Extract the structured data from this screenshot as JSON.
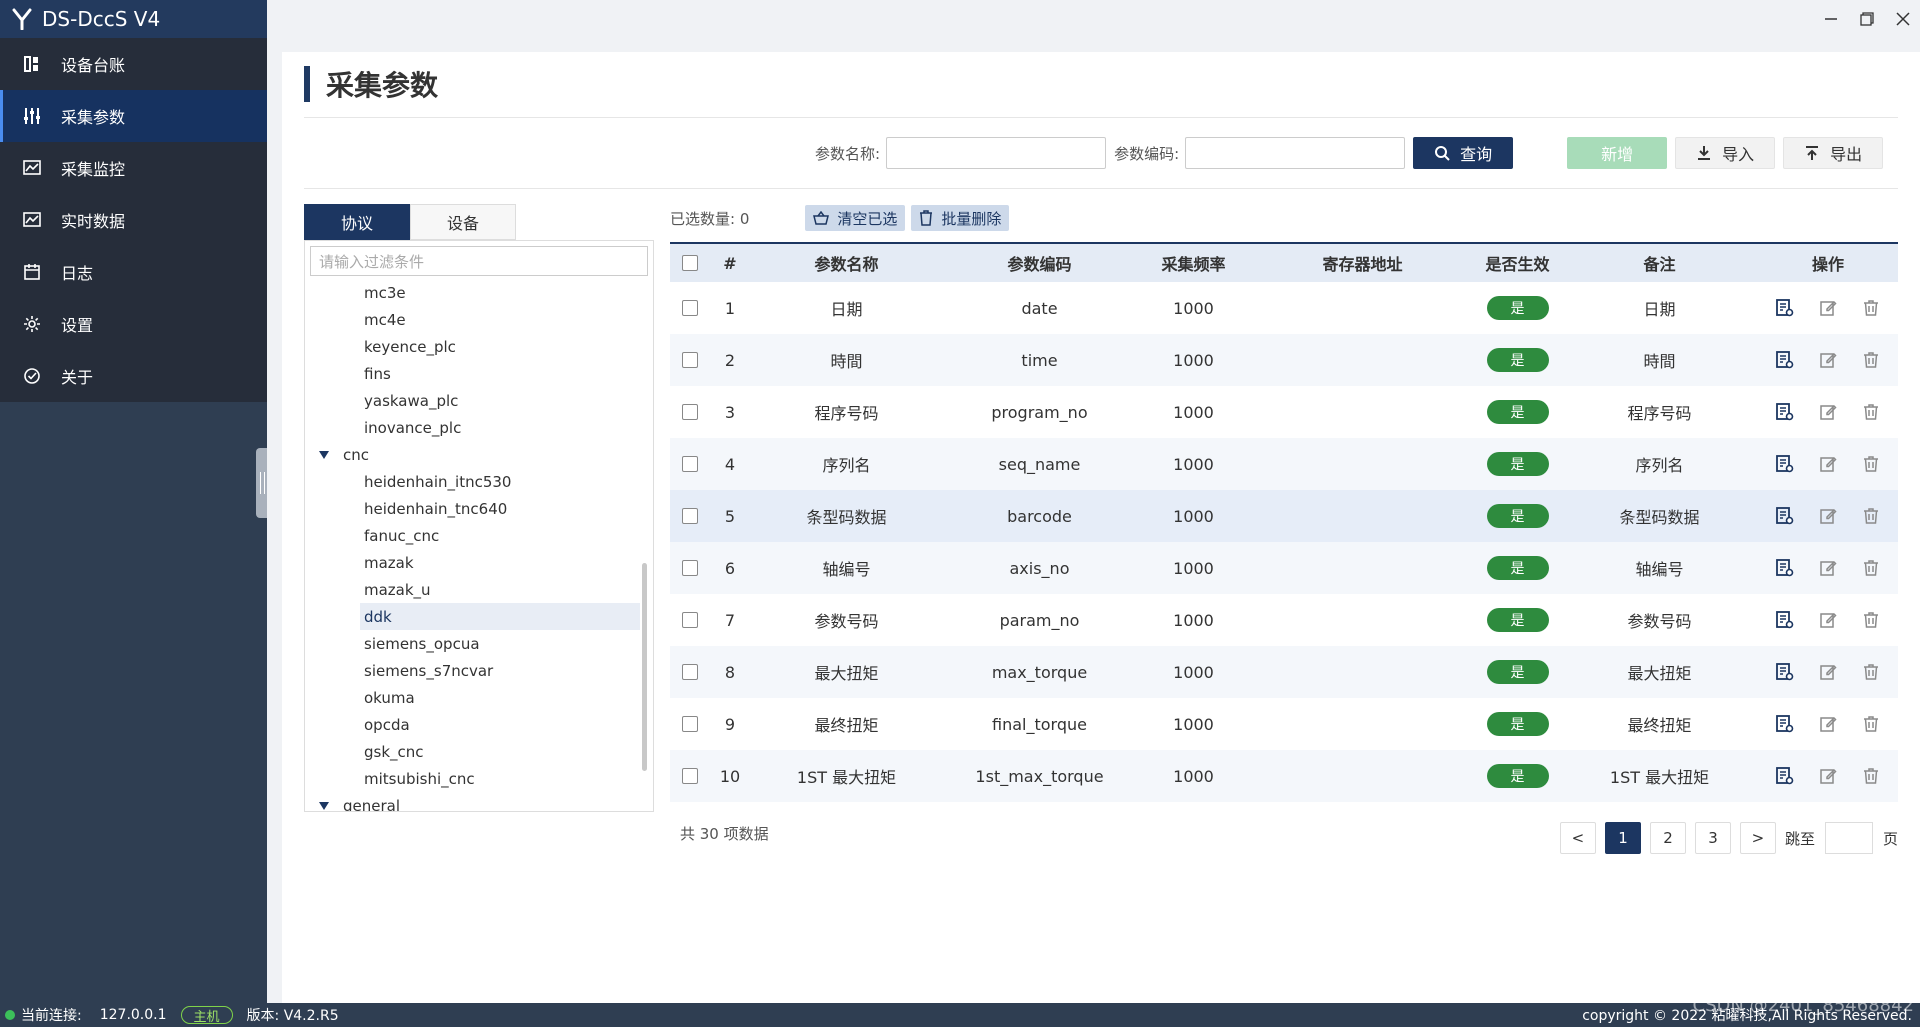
{
  "app": {
    "title": "DS-DccS V4"
  },
  "sidebar": {
    "items": [
      {
        "label": "设备台账",
        "icon": "ledger-icon"
      },
      {
        "label": "采集参数",
        "icon": "sliders-icon",
        "active": true
      },
      {
        "label": "采集监控",
        "icon": "chart-icon"
      },
      {
        "label": "实时数据",
        "icon": "chart-icon"
      },
      {
        "label": "日志",
        "icon": "calendar-icon"
      },
      {
        "label": "设置",
        "icon": "gear-icon"
      },
      {
        "label": "关于",
        "icon": "check-circle-icon"
      }
    ]
  },
  "page": {
    "title": "采集参数"
  },
  "search": {
    "param_name_label": "参数名称:",
    "param_code_label": "参数编码:",
    "query_label": "查询",
    "add_label": "新增",
    "import_label": "导入",
    "export_label": "导出"
  },
  "left_panel": {
    "tabs": [
      "协议",
      "设备"
    ],
    "filter_placeholder": "请输入过滤条件",
    "tree": [
      {
        "label": "mc3e",
        "type": "child"
      },
      {
        "label": "mc4e",
        "type": "child"
      },
      {
        "label": "keyence_plc",
        "type": "child"
      },
      {
        "label": "fins",
        "type": "child"
      },
      {
        "label": "yaskawa_plc",
        "type": "child"
      },
      {
        "label": "inovance_plc",
        "type": "child"
      },
      {
        "label": "cnc",
        "type": "parent"
      },
      {
        "label": "heidenhain_itnc530",
        "type": "child"
      },
      {
        "label": "heidenhain_tnc640",
        "type": "child"
      },
      {
        "label": "fanuc_cnc",
        "type": "child"
      },
      {
        "label": "mazak",
        "type": "child"
      },
      {
        "label": "mazak_u",
        "type": "child"
      },
      {
        "label": "ddk",
        "type": "child",
        "selected": true
      },
      {
        "label": "siemens_opcua",
        "type": "child"
      },
      {
        "label": "siemens_s7ncvar",
        "type": "child"
      },
      {
        "label": "okuma",
        "type": "child"
      },
      {
        "label": "opcda",
        "type": "child"
      },
      {
        "label": "gsk_cnc",
        "type": "child"
      },
      {
        "label": "mitsubishi_cnc",
        "type": "child"
      },
      {
        "label": "general",
        "type": "parent"
      }
    ]
  },
  "table": {
    "selected_label": "已选数量: 0",
    "clear_label": "清空已选",
    "batch_delete_label": "批量删除",
    "headers": [
      "#",
      "参数名称",
      "参数编码",
      "采集频率",
      "寄存器地址",
      "是否生效",
      "备注",
      "操作"
    ],
    "rows": [
      {
        "no": "1",
        "name": "日期",
        "code": "date",
        "freq": "1000",
        "register": "",
        "active": "是",
        "remark": "日期"
      },
      {
        "no": "2",
        "name": "時間",
        "code": "time",
        "freq": "1000",
        "register": "",
        "active": "是",
        "remark": "時間"
      },
      {
        "no": "3",
        "name": "程序号码",
        "code": "program_no",
        "freq": "1000",
        "register": "",
        "active": "是",
        "remark": "程序号码"
      },
      {
        "no": "4",
        "name": "序列名",
        "code": "seq_name",
        "freq": "1000",
        "register": "",
        "active": "是",
        "remark": "序列名"
      },
      {
        "no": "5",
        "name": "条型码数据",
        "code": "barcode",
        "freq": "1000",
        "register": "",
        "active": "是",
        "remark": "条型码数据"
      },
      {
        "no": "6",
        "name": "轴编号",
        "code": "axis_no",
        "freq": "1000",
        "register": "",
        "active": "是",
        "remark": "轴编号"
      },
      {
        "no": "7",
        "name": "参数号码",
        "code": "param_no",
        "freq": "1000",
        "register": "",
        "active": "是",
        "remark": "参数号码"
      },
      {
        "no": "8",
        "name": "最大扭矩",
        "code": "max_torque",
        "freq": "1000",
        "register": "",
        "active": "是",
        "remark": "最大扭矩"
      },
      {
        "no": "9",
        "name": "最终扭矩",
        "code": "final_torque",
        "freq": "1000",
        "register": "",
        "active": "是",
        "remark": "最终扭矩"
      },
      {
        "no": "10",
        "name": "1ST 最大扭矩",
        "code": "1st_max_torque",
        "freq": "1000",
        "register": "",
        "active": "是",
        "remark": "1ST 最大扭矩"
      }
    ],
    "total_label": "共 30 项数据"
  },
  "pager": {
    "prev": "<",
    "pages": [
      "1",
      "2",
      "3"
    ],
    "current": "1",
    "next": ">",
    "goto_label": "跳至",
    "page_suffix": "页"
  },
  "status": {
    "conn_label": "当前连接:",
    "ip": "127.0.0.1",
    "host_badge": "主机",
    "version": "版本: V4.2.R5",
    "copyright": "copyright © 2022 粘曜科技,All Rights Reserved."
  },
  "watermark": "CSDN @2401_85468842",
  "colors": {
    "primary": "#1c3661",
    "sidebar": "#2f3e52",
    "success": "#2e8b3e",
    "add_disabled": "#a8dcb9"
  }
}
